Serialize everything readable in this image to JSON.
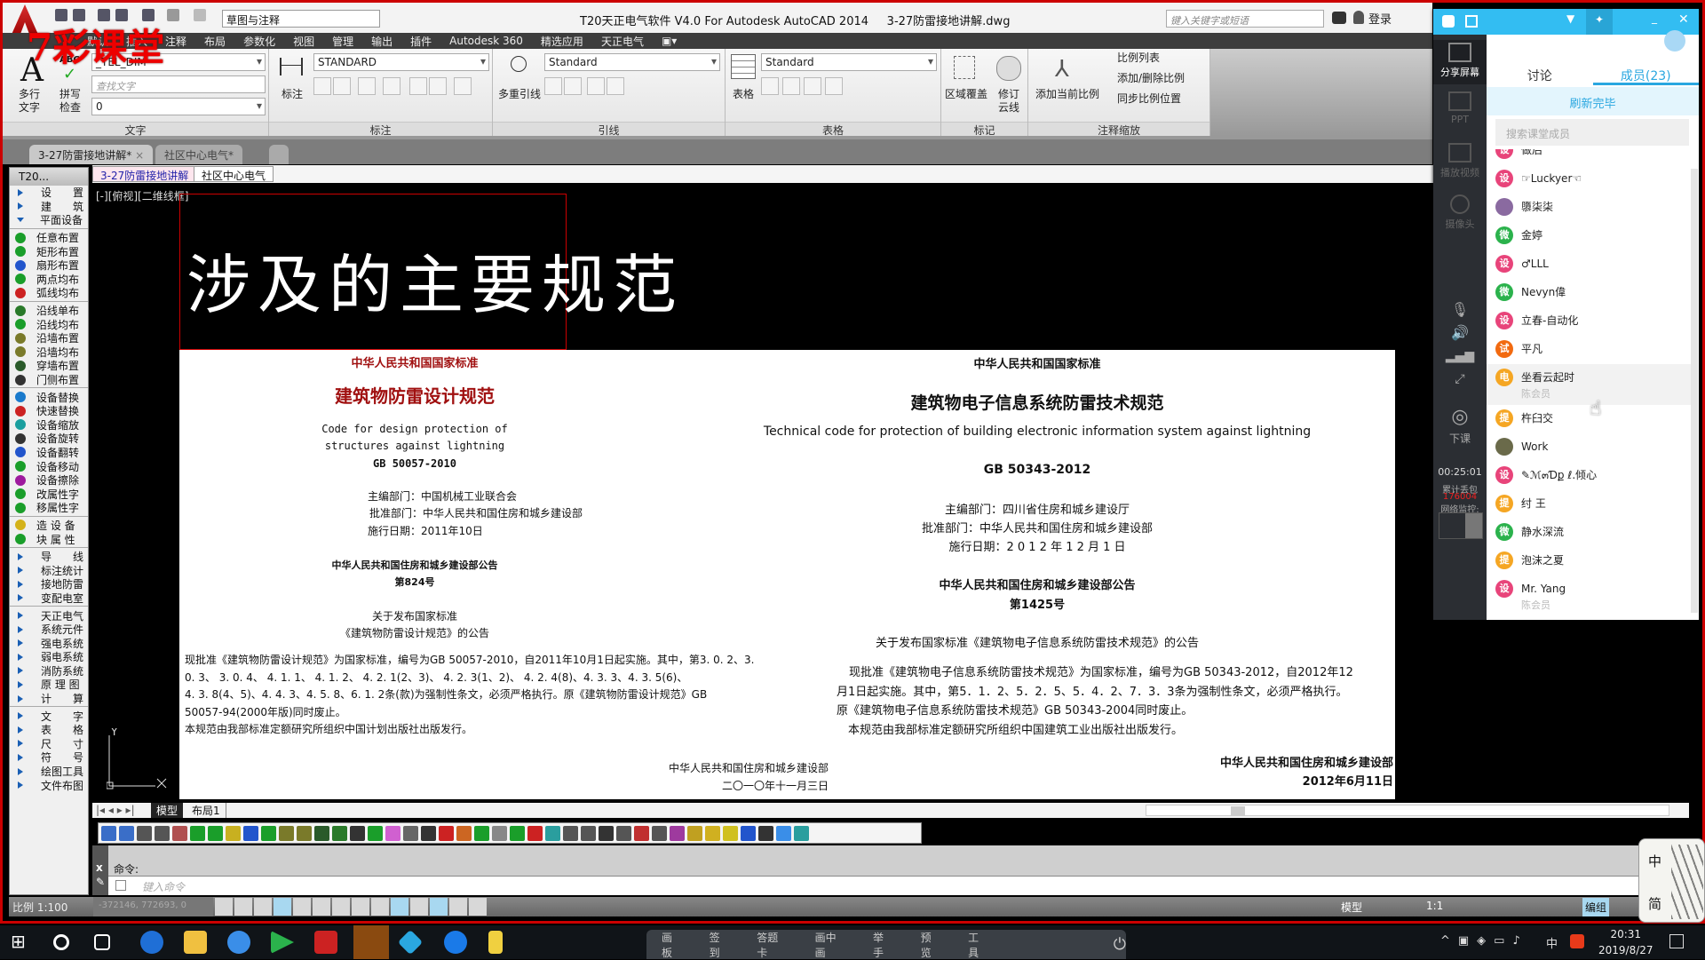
{
  "watermark": "7彩课堂",
  "titlebar": {
    "title": "T20天正电气软件 V4.0 For Autodesk AutoCAD 2014     3-27防雷接地讲解.dwg",
    "workspace": "草图与注释",
    "search_placeholder": "键入关键字或短语",
    "login": "登录"
  },
  "menu": [
    "默认",
    "插入",
    "注释",
    "布局",
    "参数化",
    "视图",
    "管理",
    "输出",
    "插件",
    "Autodesk 360",
    "精选应用",
    "天正电气"
  ],
  "ribbon": {
    "text_panel": {
      "title": "文字",
      "mtext": "多行\n文字",
      "spell": "拼写\n检查",
      "abc": "ABC",
      "style": "_TEL_DIM",
      "find_placeholder": "查找文字",
      "layer": "0"
    },
    "dim_panel": {
      "title": "标注",
      "dim": "标注",
      "style": "STANDARD"
    },
    "leader_panel": {
      "title": "引线",
      "mleader": "多重引线",
      "style": "Standard"
    },
    "table_panel": {
      "title": "表格",
      "table": "表格",
      "style": "Standard"
    },
    "markup_panel": {
      "title": "标记",
      "wipeout": "区域覆盖",
      "revcloud": "修订\n云线"
    },
    "scale_panel": {
      "title": "注释缩放",
      "add_current": "添加当前比例",
      "scale_list": "比例列表",
      "add_delete": "添加/删除比例",
      "sync": "同步比例位置"
    }
  },
  "doc_tabs": [
    {
      "label": "3-27防雷接地讲解*",
      "active": true
    },
    {
      "label": "社区中心电气*",
      "active": false
    }
  ],
  "drawing_tabs": [
    "3-27防雷接地讲解",
    "社区中心电气"
  ],
  "palette": {
    "title": "T20...",
    "groups": [
      [
        {
          "label": "设　　置",
          "kind": "arrow"
        },
        {
          "label": "建　　筑",
          "kind": "arrow"
        },
        {
          "label": "平面设备",
          "kind": "down"
        }
      ],
      [
        {
          "label": "任意布置",
          "color": "#1a9e2a"
        },
        {
          "label": "矩形布置",
          "color": "#1a9e2a"
        },
        {
          "label": "扇形布置",
          "color": "#2255cc"
        },
        {
          "label": "两点均布",
          "color": "#1a9e2a"
        },
        {
          "label": "弧线均布",
          "color": "#cc2222"
        }
      ],
      [
        {
          "label": "沿线单布",
          "color": "#2a7a2a"
        },
        {
          "label": "沿线均布",
          "color": "#1a9e2a"
        },
        {
          "label": "沿墙布置",
          "color": "#7a7a2a"
        },
        {
          "label": "沿墙均布",
          "color": "#7a7a2a"
        },
        {
          "label": "穿墙布置",
          "color": "#2a5a2a"
        },
        {
          "label": "门侧布置",
          "color": "#333333"
        }
      ],
      [
        {
          "label": "设备替换",
          "color": "#1a7acc"
        },
        {
          "label": "快速替换",
          "color": "#cc2222"
        },
        {
          "label": "设备缩放",
          "color": "#1a9e9e"
        },
        {
          "label": "设备旋转",
          "color": "#333333"
        },
        {
          "label": "设备翻转",
          "color": "#2255cc"
        },
        {
          "label": "设备移动",
          "color": "#1a9e2a"
        },
        {
          "label": "设备擦除",
          "color": "#9e1a9e"
        },
        {
          "label": "改属性字",
          "color": "#1a9e2a"
        },
        {
          "label": "移属性字",
          "color": "#1a9e2a"
        }
      ],
      [
        {
          "label": "造 设 备",
          "color": "#d4b21a"
        },
        {
          "label": "块 属 性",
          "color": "#1a9e2a"
        }
      ],
      [
        {
          "label": "导　　线",
          "kind": "arrow"
        },
        {
          "label": "标注统计",
          "kind": "arrow"
        },
        {
          "label": "接地防雷",
          "kind": "arrow"
        },
        {
          "label": "变配电室",
          "kind": "arrow"
        }
      ],
      [
        {
          "label": "天正电气",
          "kind": "arrow"
        },
        {
          "label": "系统元件",
          "kind": "arrow"
        },
        {
          "label": "强电系统",
          "kind": "arrow"
        },
        {
          "label": "弱电系统",
          "kind": "arrow"
        },
        {
          "label": "消防系统",
          "kind": "arrow"
        },
        {
          "label": "原 理 图",
          "kind": "arrow"
        },
        {
          "label": "计　　算",
          "kind": "arrow"
        }
      ],
      [
        {
          "label": "文　　字",
          "kind": "arrow"
        },
        {
          "label": "表　　格",
          "kind": "arrow"
        },
        {
          "label": "尺　　寸",
          "kind": "arrow"
        },
        {
          "label": "符　　号",
          "kind": "arrow"
        },
        {
          "label": "绘图工具",
          "kind": "arrow"
        },
        {
          "label": "文件布图",
          "kind": "arrow"
        }
      ]
    ]
  },
  "viewport": {
    "label": "[-][俯视][二维线框]",
    "heading": "涉及的主要规范",
    "ucs_y": "Y"
  },
  "doc_left": {
    "header": "中华人民共和国国家标准",
    "title": "建筑物防雷设计规范",
    "en1": "Code for design protection of",
    "en2": "structures against lightning",
    "code": "GB 50057-2010",
    "editor": "主编部门：中国机械工业联合会",
    "approver": "批准部门：中华人民共和国住房和城乡建设部",
    "date": "施行日期：2011年10日",
    "notice": "中华人民共和国住房和城乡建设部公告",
    "number": "第824号",
    "about1": "关于发布国家标准",
    "about2": "《建筑物防雷设计规范》的公告",
    "para": [
      "现批准《建筑物防雷设计规范》为国家标准，编号为GB 50057-2010，自2011年10月1日起实施。其中，第3. 0. 2、3.",
      "0. 3、 3. 0. 4、 4. 1. 1、 4. 1. 2、 4. 2. 1(2、3)、 4. 2. 3(1、2)、 4. 2. 4(8)、4. 3. 3、4. 3. 5(6)、",
      "4. 3. 8(4、5)、4. 4. 3、4. 5. 8、6. 1. 2条(款)为强制性条文，必须严格执行。原《建筑物防雷设计规范》GB",
      "50057-94(2000年版)同时废止。",
      "本规范由我部标准定额研究所组织中国计划出版社出版发行。"
    ],
    "sign": "中华人民共和国住房和城乡建设部",
    "sign_date": "二〇一〇年十一月三日"
  },
  "doc_right": {
    "header": "中华人民共和国国家标准",
    "title": "建筑物电子信息系统防雷技术规范",
    "en": "Technical code for protection of building electronic information system against lightning",
    "code": "GB 50343-2012",
    "editor": "主编部门：四川省住房和城乡建设厅",
    "approver": "批准部门：中华人民共和国住房和城乡建设部",
    "date": "施行日期：2 0 1 2 年 1 2 月 1 日",
    "notice": "中华人民共和国住房和城乡建设部公告",
    "number": "第1425号",
    "about": "关于发布国家标准《建筑物电子信息系统防雷技术规范》的公告",
    "para": [
      "现批准《建筑物电子信息系统防雷技术规范》为国家标准，编号为GB 50343-2012，自2012年12",
      "月1日起实施。其中，第5．1．2、5．2．5、5．4．2、7．3．3条为强制性条文，必须严格执行。",
      "原《建筑物电子信息系统防雷技术规范》GB 50343-2004同时废止。",
      "　本规范由我部标准定额研究所组织中国建筑工业出版社出版发行。"
    ],
    "sign": "中华人民共和国住房和城乡建设部",
    "sign_date": "2012年6月11日"
  },
  "layout_tabs": [
    "模型",
    "布局1"
  ],
  "command": {
    "label": "命令:",
    "placeholder": "键入命令"
  },
  "status": {
    "scale": "比例 1:100",
    "coords": "-372146, 772693, 0",
    "model": "模型",
    "anno_scale": "1:1",
    "group": "编组"
  },
  "class_panel": {
    "tabs": [
      "讨论",
      "成员(23)"
    ],
    "refresh": "刷新完毕",
    "search_placeholder": "搜索课堂成员",
    "side": {
      "share": "分享屏幕",
      "ppt": "PPT",
      "video": "播放视频",
      "camera": "摄像头",
      "end": "下课",
      "timer": "00:25:01",
      "loss_label": "累计丢包",
      "loss": "176004",
      "net": "网络监控:"
    },
    "members": [
      {
        "badge": "设",
        "color": "#e8447a",
        "name": "做后"
      },
      {
        "badge": "设",
        "color": "#e8447a",
        "name": "☞Luckyer☜"
      },
      {
        "badge": "",
        "color": "#8a6aa0",
        "name": "隳柒柒"
      },
      {
        "badge": "微",
        "color": "#2bb24c",
        "name": "金婷"
      },
      {
        "badge": "设",
        "color": "#e8447a",
        "name": "♂LLL"
      },
      {
        "badge": "微",
        "color": "#2bb24c",
        "name": "Nevyn偉"
      },
      {
        "badge": "设",
        "color": "#e8447a",
        "name": "立春-自动化"
      },
      {
        "badge": "试",
        "color": "#f26a10",
        "name": "平凡"
      },
      {
        "badge": "电",
        "color": "#f5a623",
        "name": "坐看云起时",
        "sub": "陈会员",
        "highlight": true
      },
      {
        "badge": "提",
        "color": "#f5a623",
        "name": "杵臼交"
      },
      {
        "badge": "",
        "color": "#6a6a4a",
        "name": "Work"
      },
      {
        "badge": "设",
        "color": "#e8447a",
        "name": "✎ℳ๓Ɗք ℓ.倾心"
      },
      {
        "badge": "提",
        "color": "#f5a623",
        "name": "纣 王"
      },
      {
        "badge": "微",
        "color": "#2bb24c",
        "name": "静水深流"
      },
      {
        "badge": "提",
        "color": "#f5a623",
        "name": "泡沫之夏"
      },
      {
        "badge": "设",
        "color": "#e8447a",
        "name": "Mr. Yang",
        "sub": "陈会员"
      }
    ]
  },
  "taskbar": {
    "class_buttons": [
      "画板",
      "签到",
      "答题卡",
      "画中画",
      "举手",
      "预览",
      "工具"
    ],
    "time": "20:31",
    "date": "2019/8/27",
    "ime": "中"
  },
  "ime_widget": {
    "line1": "中",
    "line2": "简"
  }
}
